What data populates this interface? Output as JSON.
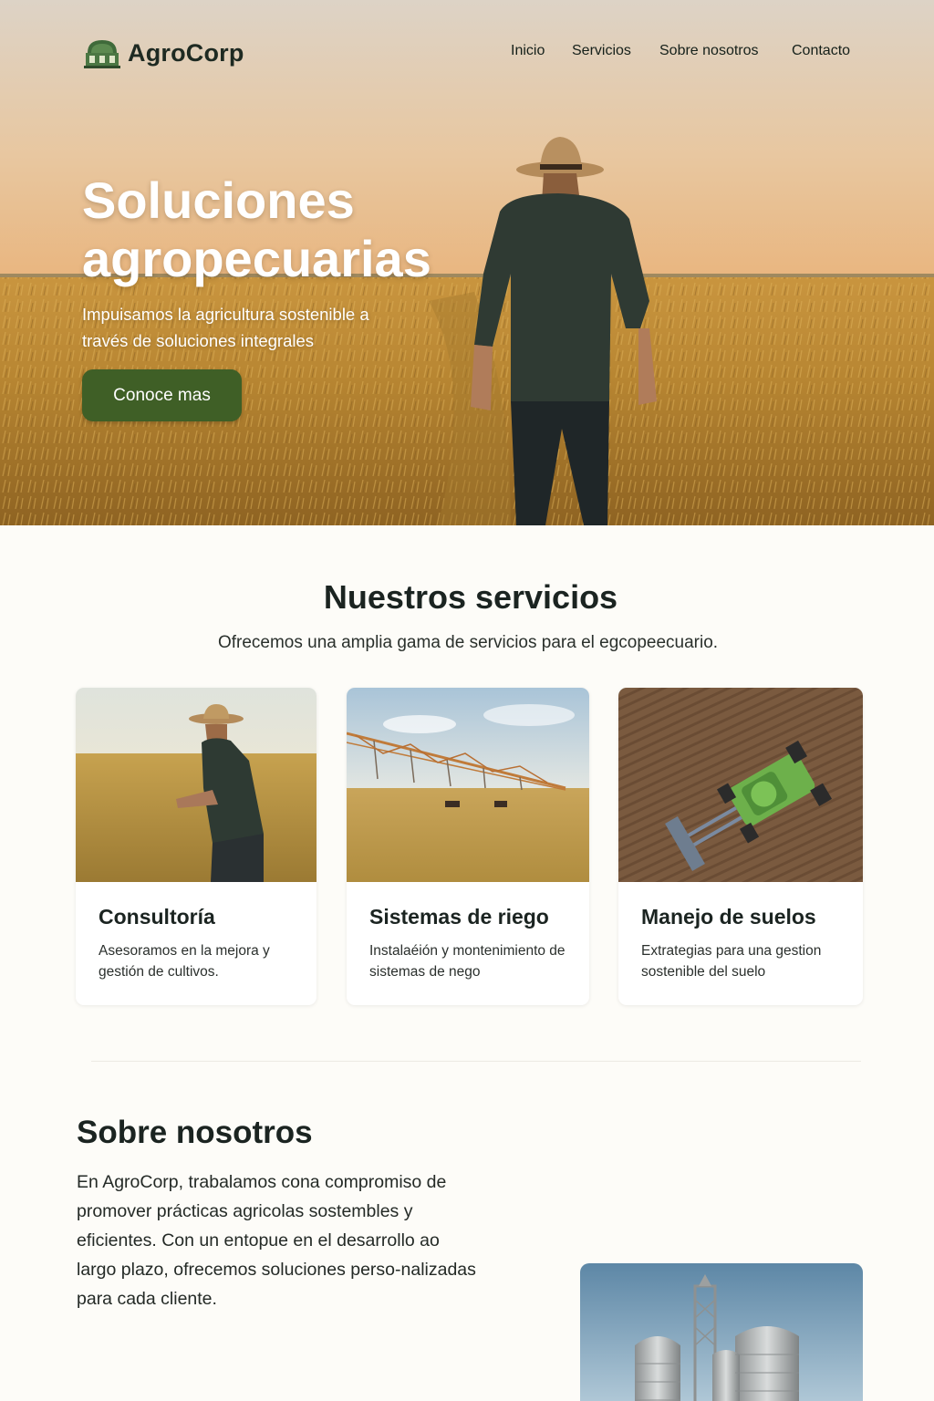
{
  "brand": {
    "name": "AgroCorp"
  },
  "nav": {
    "items": [
      "Inicio",
      "Servicios",
      "Sobre nosotros",
      "Contacto"
    ]
  },
  "hero": {
    "title": "Soluciones agropecuarias",
    "subtitle": "Impuisamos la agricultura sostenible a través de soluciones integrales",
    "cta_label": "Conoce mas"
  },
  "services": {
    "title": "Nuestros servicios",
    "subtitle": "Ofrecemos una amplia gama de servicios para el egcopeecuario.",
    "cards": [
      {
        "title": "Consultoría",
        "text": "Asesoramos en la mejora y gestión de cultivos."
      },
      {
        "title": "Sistemas de riego",
        "text": "Instalaéión y montenimiento de sistemas de nego"
      },
      {
        "title": "Manejo de suelos",
        "text": "Extrategias para una gestion sostenible del suelo"
      }
    ]
  },
  "about": {
    "title": "Sobre nosotros",
    "text": "En AgroCorp, trabalamos cona compromiso de promover prácticas agricolas sostembles y eficientes. Con un entopue en el desarrollo ao largo plazo, ofrecemos soluciones perso-nalizadas para cada cliente."
  },
  "colors": {
    "primary_button": "#3f5f26",
    "text_dark": "#1b2421",
    "page_bg": "#fdfcf8"
  },
  "icons": {
    "logo": "silo-logo-icon"
  }
}
